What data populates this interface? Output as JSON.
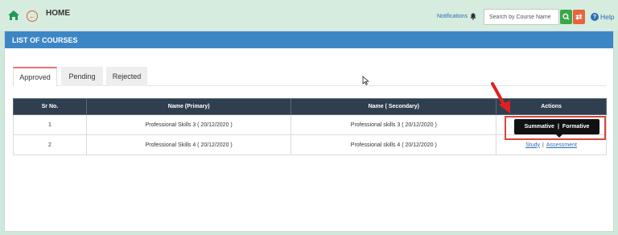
{
  "header": {
    "title": "HOME",
    "notifications_label": "Notifications",
    "search_placeholder": "Search by Course Name",
    "refresh_glyph": "⇄",
    "help_label": "Help",
    "help_glyph": "?",
    "back_glyph": "←"
  },
  "panel": {
    "title": "LIST OF COURSES"
  },
  "tabs": [
    {
      "label": "Approved",
      "active": true
    },
    {
      "label": "Pending",
      "active": false
    },
    {
      "label": "Rejected",
      "active": false
    }
  ],
  "table": {
    "columns": [
      "Sr No.",
      "Name (Primary)",
      "Name ( Secondary)",
      "Actions"
    ],
    "rows": [
      {
        "sr": "1",
        "primary": "Professional Skills 3 ( 20/12/2020 )",
        "secondary": "Professional skills 3 ( 20/12/2020 )",
        "actions": []
      },
      {
        "sr": "2",
        "primary": "Professional Skills 4 ( 20/12/2020 )",
        "secondary": "Professional skills 4 ( 20/12/2020 )",
        "actions": [
          "Study",
          "Assessment"
        ]
      }
    ],
    "action_separator": "|"
  },
  "tooltip": {
    "items": [
      "Summative",
      "Formative"
    ],
    "separator": "|"
  },
  "colors": {
    "header_bar": "#3d86c6",
    "table_header": "#2f3f4f",
    "search_button": "#3aa84a",
    "refresh_button": "#e8643a",
    "highlight": "#d9463b",
    "link": "#2b6fb0"
  }
}
